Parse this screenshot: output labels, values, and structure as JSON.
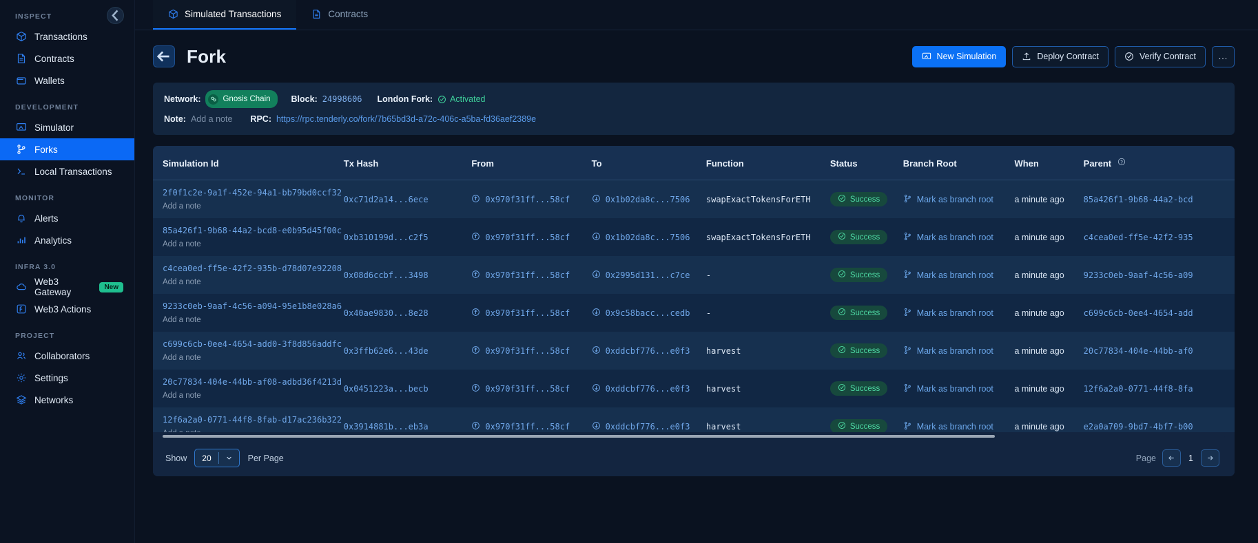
{
  "sidebar": {
    "collapse_icon": "chevron-left-icon",
    "sections": [
      {
        "label": "INSPECT",
        "items": [
          {
            "label": "Transactions",
            "icon": "cube-icon",
            "active": false
          },
          {
            "label": "Contracts",
            "icon": "document-icon",
            "active": false
          },
          {
            "label": "Wallets",
            "icon": "wallet-icon",
            "active": false
          }
        ]
      },
      {
        "label": "DEVELOPMENT",
        "items": [
          {
            "label": "Simulator",
            "icon": "monitor-icon",
            "active": false
          },
          {
            "label": "Forks",
            "icon": "fork-icon",
            "active": true
          },
          {
            "label": "Local Transactions",
            "icon": "terminal-icon",
            "active": false
          }
        ]
      },
      {
        "label": "MONITOR",
        "items": [
          {
            "label": "Alerts",
            "icon": "bell-icon",
            "active": false
          },
          {
            "label": "Analytics",
            "icon": "bar-chart-icon",
            "active": false
          }
        ]
      },
      {
        "label": "INFRA 3.0",
        "items": [
          {
            "label": "Web3 Gateway",
            "icon": "cloud-icon",
            "active": false,
            "badge": "New"
          },
          {
            "label": "Web3 Actions",
            "icon": "function-icon",
            "active": false
          }
        ]
      },
      {
        "label": "PROJECT",
        "items": [
          {
            "label": "Collaborators",
            "icon": "users-icon",
            "active": false
          },
          {
            "label": "Settings",
            "icon": "gear-icon",
            "active": false
          },
          {
            "label": "Networks",
            "icon": "layers-icon",
            "active": false
          }
        ]
      }
    ]
  },
  "tabs": [
    {
      "label": "Simulated Transactions",
      "icon": "cube-icon",
      "active": true
    },
    {
      "label": "Contracts",
      "icon": "document-icon",
      "active": false
    }
  ],
  "header": {
    "back_icon": "arrow-left-icon",
    "title": "Fork",
    "actions": [
      {
        "label": "New Simulation",
        "icon": "monitor-icon",
        "style": "primary"
      },
      {
        "label": "Deploy Contract",
        "icon": "upload-icon",
        "style": "outline"
      },
      {
        "label": "Verify Contract",
        "icon": "check-circle-icon",
        "style": "outline"
      },
      {
        "label": "...",
        "icon": "more-icon",
        "style": "outline-dots"
      }
    ]
  },
  "info": {
    "network_label": "Network:",
    "network_value": "Gnosis Chain",
    "block_label": "Block:",
    "block_value": "24998606",
    "fork_label": "London Fork:",
    "fork_value": "Activated",
    "note_label": "Note:",
    "note_value": "Add a note",
    "rpc_label": "RPC:",
    "rpc_value": "https://rpc.tenderly.co/fork/7b65bd3d-a72c-406c-a5ba-fd36aef2389e"
  },
  "table": {
    "columns": [
      "Simulation Id",
      "Tx Hash",
      "From",
      "To",
      "Function",
      "Status",
      "Branch Root",
      "When",
      "Parent"
    ],
    "parent_help_icon": "question-circle-icon",
    "add_note_label": "Add a note",
    "branch_root_label": "Mark as branch root",
    "rows": [
      {
        "sim_id": "2f0f1c2e-9a1f-452e-94a1-bb79bd0ccf32",
        "tx_hash": "0xc71d2a14...6ece",
        "from": "0x970f31ff...58cf",
        "to": "0x1b02da8c...7506",
        "function": "swapExactTokensForETH",
        "status": "Success",
        "when": "a minute ago",
        "parent": "85a426f1-9b68-44a2-bcd"
      },
      {
        "sim_id": "85a426f1-9b68-44a2-bcd8-e0b95d45f00c",
        "tx_hash": "0xb310199d...c2f5",
        "from": "0x970f31ff...58cf",
        "to": "0x1b02da8c...7506",
        "function": "swapExactTokensForETH",
        "status": "Success",
        "when": "a minute ago",
        "parent": "c4cea0ed-ff5e-42f2-935"
      },
      {
        "sim_id": "c4cea0ed-ff5e-42f2-935b-d78d07e92208",
        "tx_hash": "0x08d6ccbf...3498",
        "from": "0x970f31ff...58cf",
        "to": "0x2995d131...c7ce",
        "function": "-",
        "status": "Success",
        "when": "a minute ago",
        "parent": "9233c0eb-9aaf-4c56-a09"
      },
      {
        "sim_id": "9233c0eb-9aaf-4c56-a094-95e1b8e028a6",
        "tx_hash": "0x40ae9830...8e28",
        "from": "0x970f31ff...58cf",
        "to": "0x9c58bacc...cedb",
        "function": "-",
        "status": "Success",
        "when": "a minute ago",
        "parent": "c699c6cb-0ee4-4654-add"
      },
      {
        "sim_id": "c699c6cb-0ee4-4654-add0-3f8d856addfc",
        "tx_hash": "0x3ffb62e6...43de",
        "from": "0x970f31ff...58cf",
        "to": "0xddcbf776...e0f3",
        "function": "harvest",
        "status": "Success",
        "when": "a minute ago",
        "parent": "20c77834-404e-44bb-af0"
      },
      {
        "sim_id": "20c77834-404e-44bb-af08-adbd36f4213d",
        "tx_hash": "0x0451223a...becb",
        "from": "0x970f31ff...58cf",
        "to": "0xddcbf776...e0f3",
        "function": "harvest",
        "status": "Success",
        "when": "a minute ago",
        "parent": "12f6a2a0-0771-44f8-8fa"
      },
      {
        "sim_id": "12f6a2a0-0771-44f8-8fab-d17ac236b322",
        "tx_hash": "0x3914881b...eb3a",
        "from": "0x970f31ff...58cf",
        "to": "0xddcbf776...e0f3",
        "function": "harvest",
        "status": "Success",
        "when": "a minute ago",
        "parent": "e2a0a709-9bd7-4bf7-b00"
      }
    ]
  },
  "footer": {
    "show_label": "Show",
    "per_page_value": "20",
    "per_page_label": "Per Page",
    "page_label": "Page",
    "page_number": "1",
    "prev_icon": "arrow-left-icon",
    "next_icon": "arrow-right-icon"
  },
  "colors": {
    "accent": "#0b71f5",
    "success": "#4edaa4",
    "network_chip": "#12805c",
    "badge_new": "#1fbf8f"
  }
}
